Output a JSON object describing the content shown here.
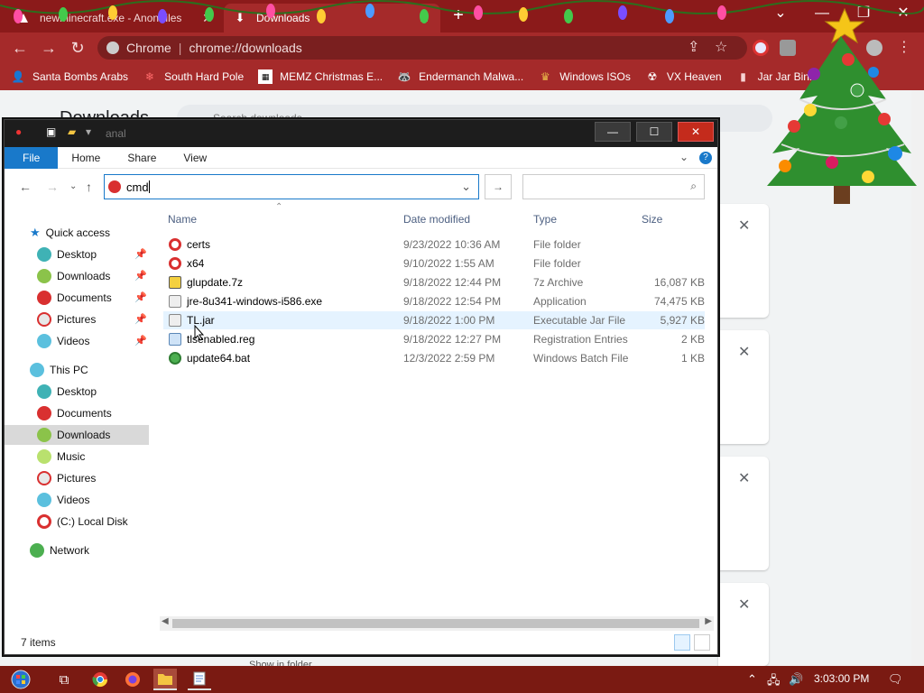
{
  "browser": {
    "tabs": [
      {
        "label": "newminecraft.exe - AnonFiles",
        "icon": "anonfiles-icon",
        "active": false
      },
      {
        "label": "Downloads",
        "icon": "download-icon",
        "active": true
      }
    ],
    "omnibox": {
      "site": "Chrome",
      "url": "chrome://downloads"
    },
    "bookmarks": [
      {
        "label": "Santa Bombs Arabs",
        "icon": "person-icon"
      },
      {
        "label": "South Hard Pole",
        "icon": "snowflake-icon"
      },
      {
        "label": "MEMZ Christmas E...",
        "icon": "memz-icon"
      },
      {
        "label": "Endermanch Malwa...",
        "icon": "raccoon-icon"
      },
      {
        "label": "Windows ISOs",
        "icon": "trophy-icon"
      },
      {
        "label": "VX Heaven",
        "icon": "vx-icon"
      },
      {
        "label": "Jar Jar Binks",
        "icon": "jar-icon"
      }
    ],
    "page_title": "Downloads",
    "search_placeholder": "Search downloads",
    "bottom_partial_text": "Show in folder"
  },
  "explorer": {
    "title": "anal",
    "ribbon_tabs": [
      "File",
      "Home",
      "Share",
      "View"
    ],
    "address_value": "cmd",
    "nav_pane": {
      "quick_access": "Quick access",
      "quick_items": [
        "Desktop",
        "Downloads",
        "Documents",
        "Pictures",
        "Videos"
      ],
      "this_pc": "This PC",
      "pc_items": [
        "Desktop",
        "Documents",
        "Downloads",
        "Music",
        "Pictures",
        "Videos",
        "(C:) Local Disk"
      ],
      "network": "Network",
      "selected": "Downloads"
    },
    "columns": [
      "Name",
      "Date modified",
      "Type",
      "Size"
    ],
    "files": [
      {
        "name": "certs",
        "date": "9/23/2022 10:36 AM",
        "type": "File folder",
        "size": "",
        "icon": "folder-ornament-icon"
      },
      {
        "name": "x64",
        "date": "9/10/2022 1:55 AM",
        "type": "File folder",
        "size": "",
        "icon": "folder-ornament-icon"
      },
      {
        "name": "glupdate.7z",
        "date": "9/18/2022 12:44 PM",
        "type": "7z Archive",
        "size": "16,087 KB",
        "icon": "archive-icon"
      },
      {
        "name": "jre-8u341-windows-i586.exe",
        "date": "9/18/2022 12:54 PM",
        "type": "Application",
        "size": "74,475 KB",
        "icon": "exe-icon"
      },
      {
        "name": "TL.jar",
        "date": "9/18/2022 1:00 PM",
        "type": "Executable Jar File",
        "size": "5,927 KB",
        "icon": "jar-file-icon"
      },
      {
        "name": "tlsenabled.reg",
        "date": "9/18/2022 12:27 PM",
        "type": "Registration Entries",
        "size": "2 KB",
        "icon": "reg-icon"
      },
      {
        "name": "update64.bat",
        "date": "12/3/2022 2:59 PM",
        "type": "Windows Batch File",
        "size": "1 KB",
        "icon": "bat-icon"
      }
    ],
    "status": "7 items"
  },
  "taskbar": {
    "items": [
      "start-icon",
      "task-view-icon",
      "chrome-icon",
      "firefox-icon",
      "file-explorer-icon",
      "notepad-icon"
    ],
    "clock": "3:03:00 PM"
  },
  "colors": {
    "chrome_frame": "#a52a2a",
    "tabbar": "#8b1a1a",
    "explorer_accent": "#1979ca",
    "taskbar": "#7a1a12"
  }
}
